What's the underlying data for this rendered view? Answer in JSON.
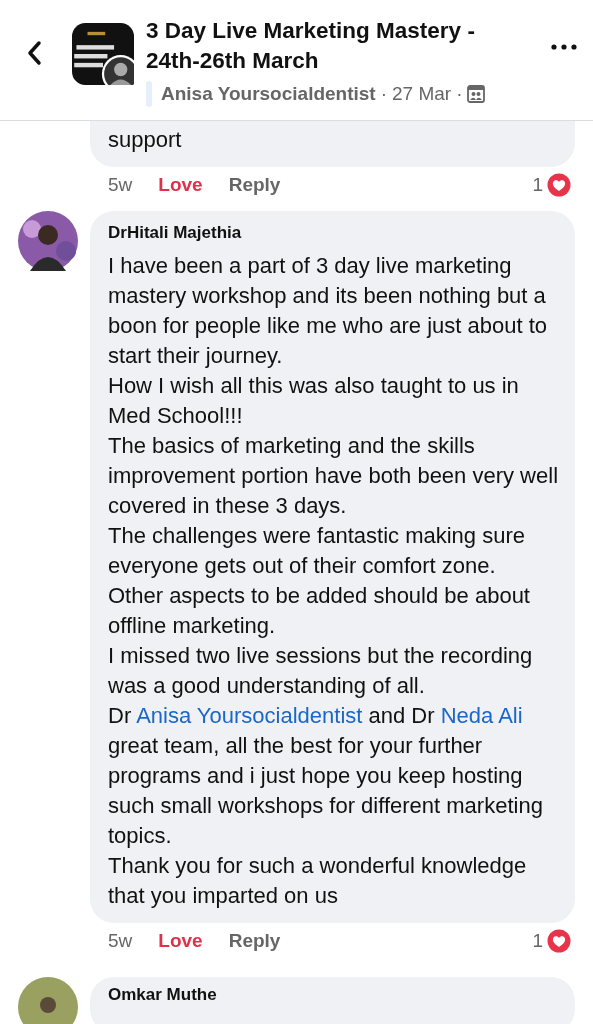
{
  "header": {
    "title": "3 Day Live Marketing Mastery - 24th-26th March",
    "author": "Anisa Yoursocialdentist",
    "separator_1": "·",
    "date": "27 Mar",
    "separator_2": "·"
  },
  "comments": [
    {
      "kind": "tail",
      "text": "support",
      "time": "5w",
      "love": "Love",
      "loved": true,
      "reply": "Reply",
      "reaction_count": "1"
    },
    {
      "kind": "full",
      "name": "DrHitali Majethia",
      "paragraphs": [
        [
          {
            "text": "I have been a part of 3 day live marketing mastery workshop and its been nothing but a boon for people like me who are just about to start their journey.",
            "link": false
          }
        ],
        [
          {
            "text": "How I wish all this was also taught to us in Med School!!!",
            "link": false
          }
        ],
        [
          {
            "text": "The basics of marketing and the skills improvement portion have both been very well covered in these 3 days.",
            "link": false
          }
        ],
        [
          {
            "text": "The challenges were fantastic making sure everyone gets out of their comfort zone.",
            "link": false
          }
        ],
        [
          {
            "text": "Other aspects to be added should be about offline marketing.",
            "link": false
          }
        ],
        [
          {
            "text": "I missed two live sessions but the recording was a good understanding of all.",
            "link": false
          }
        ],
        [
          {
            "text": "Dr ",
            "link": false
          },
          {
            "text": "Anisa Yoursocialdentist",
            "link": true
          },
          {
            "text": " and Dr ",
            "link": false
          },
          {
            "text": "Neda Ali",
            "link": true
          },
          {
            "text": " great team, all the best for your further programs and i just hope you keep hosting such small workshops for different marketing topics.",
            "link": false
          }
        ],
        [
          {
            "text": "Thank you for such a wonderful knowledge that you imparted on us",
            "link": false
          }
        ]
      ],
      "time": "5w",
      "love": "Love",
      "loved": true,
      "reply": "Reply",
      "reaction_count": "1"
    },
    {
      "kind": "peek",
      "name": "Omkar Muthe"
    }
  ]
}
